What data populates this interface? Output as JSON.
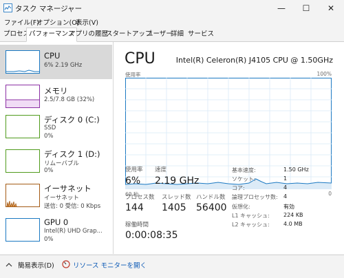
{
  "window": {
    "title": "タスク マネージャー",
    "minimize": "—",
    "maximize": "☐",
    "close": "✕"
  },
  "menu": [
    "ファイル(F)",
    "オプション(O)",
    "表示(V)"
  ],
  "tabs": [
    "プロセス",
    "パフォーマンス",
    "アプリの履歴",
    "スタートアップ",
    "ユーザー",
    "詳細",
    "サービス"
  ],
  "sidebar": [
    {
      "title": "CPU",
      "sub1": "6%  2.19 GHz",
      "sub2": "",
      "color": "#1a78c2"
    },
    {
      "title": "メモリ",
      "sub1": "2.5/7.8 GB (32%)",
      "sub2": "",
      "color": "#8b2fa3"
    },
    {
      "title": "ディスク 0 (C:)",
      "sub1": "SSD",
      "sub2": "0%",
      "color": "#4f9a1b"
    },
    {
      "title": "ディスク 1 (D:)",
      "sub1": "リムーバブル",
      "sub2": "0%",
      "color": "#4f9a1b"
    },
    {
      "title": "イーサネット",
      "sub1": "イーサネット",
      "sub2": "送信: 0  受信: 0 Kbps",
      "color": "#a35a14"
    },
    {
      "title": "GPU 0",
      "sub1": "Intel(R) UHD Grap...",
      "sub2": "0%",
      "color": "#1a78c2"
    }
  ],
  "main": {
    "title": "CPU",
    "processor": "Intel(R) Celeron(R) J4105 CPU @ 1.50GHz",
    "graph_label": "使用率",
    "graph_max": "100%",
    "graph_time": "60 秒",
    "graph_min": "0",
    "graph_color": "#1a78c2",
    "usage_label": "使用率",
    "usage_value": "6%",
    "speed_label": "速度",
    "speed_value": "2.19 GHz",
    "processes_label": "プロセス数",
    "processes_value": "144",
    "threads_label": "スレッド数",
    "threads_value": "1405",
    "handles_label": "ハンドル数",
    "handles_value": "56400",
    "uptime_label": "稼働時間",
    "uptime_value": "0:00:08:35",
    "details": [
      {
        "key": "基本速度:",
        "value": "1.50 GHz"
      },
      {
        "key": "ソケット:",
        "value": "1"
      },
      {
        "key": "コア:",
        "value": "4"
      },
      {
        "key": "論理プロセッサ数:",
        "value": "4"
      },
      {
        "key": "仮想化:",
        "value": "有効"
      },
      {
        "key": "L1 キャッシュ:",
        "value": "224 KB"
      },
      {
        "key": "L2 キャッシュ:",
        "value": "4.0 MB"
      }
    ]
  },
  "footer": {
    "fewer_details": "簡易表示(D)",
    "resource_monitor": "リソース モニターを開く"
  }
}
